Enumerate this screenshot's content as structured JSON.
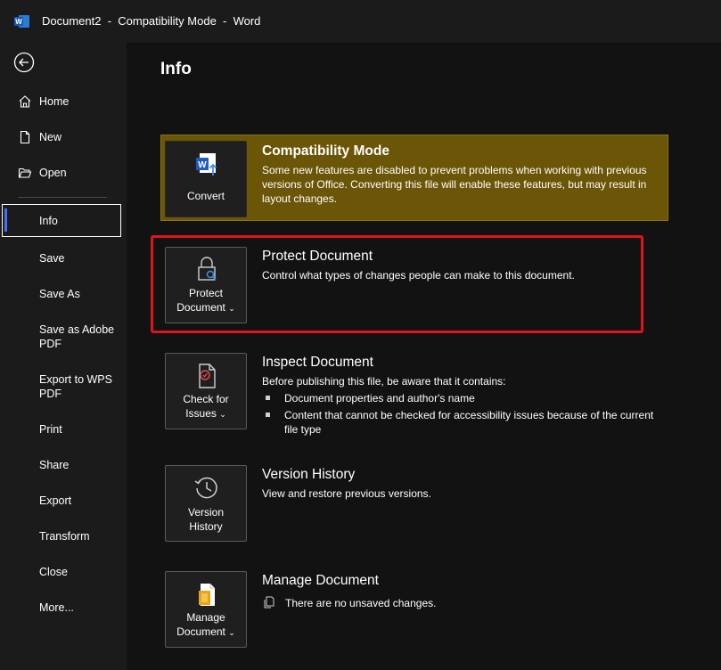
{
  "titlebar": {
    "title": "Document2  -  Compatibility Mode  -  Word"
  },
  "sidebar": {
    "back_label": "",
    "items": [
      {
        "label": "Home",
        "icon": "home-icon"
      },
      {
        "label": "New",
        "icon": "new-document-icon"
      },
      {
        "label": "Open",
        "icon": "open-folder-icon"
      },
      {
        "label": "Info"
      },
      {
        "label": "Save"
      },
      {
        "label": "Save As"
      },
      {
        "label": "Save as Adobe PDF"
      },
      {
        "label": "Export to WPS PDF"
      },
      {
        "label": "Print"
      },
      {
        "label": "Share"
      },
      {
        "label": "Export"
      },
      {
        "label": "Transform"
      },
      {
        "label": "Close"
      },
      {
        "label": "More..."
      }
    ]
  },
  "main": {
    "title": "Info",
    "compat": {
      "button_label": "Convert",
      "title": "Compatibility Mode",
      "description": "Some new features are disabled to prevent problems when working with previous versions of Office. Converting this file will enable these features, but may result in layout changes."
    },
    "protect": {
      "button_line1": "Protect",
      "button_line2": "Document",
      "title": "Protect Document",
      "description": "Control what types of changes people can make to this document."
    },
    "inspect": {
      "button_line1": "Check for",
      "button_line2": "Issues",
      "title": "Inspect Document",
      "description": "Before publishing this file, be aware that it contains:",
      "bullets": [
        "Document properties and author's name",
        "Content that cannot be checked for accessibility issues because of the current file type"
      ]
    },
    "version": {
      "button_line1": "Version",
      "button_line2": "History",
      "title": "Version History",
      "description": "View and restore previous versions."
    },
    "manage": {
      "button_line1": "Manage",
      "button_line2": "Document",
      "title": "Manage Document",
      "description": "There are no unsaved changes."
    }
  },
  "colors": {
    "accent": "#4a6df7",
    "banner": "#6b5507",
    "highlight": "#e0141c"
  }
}
